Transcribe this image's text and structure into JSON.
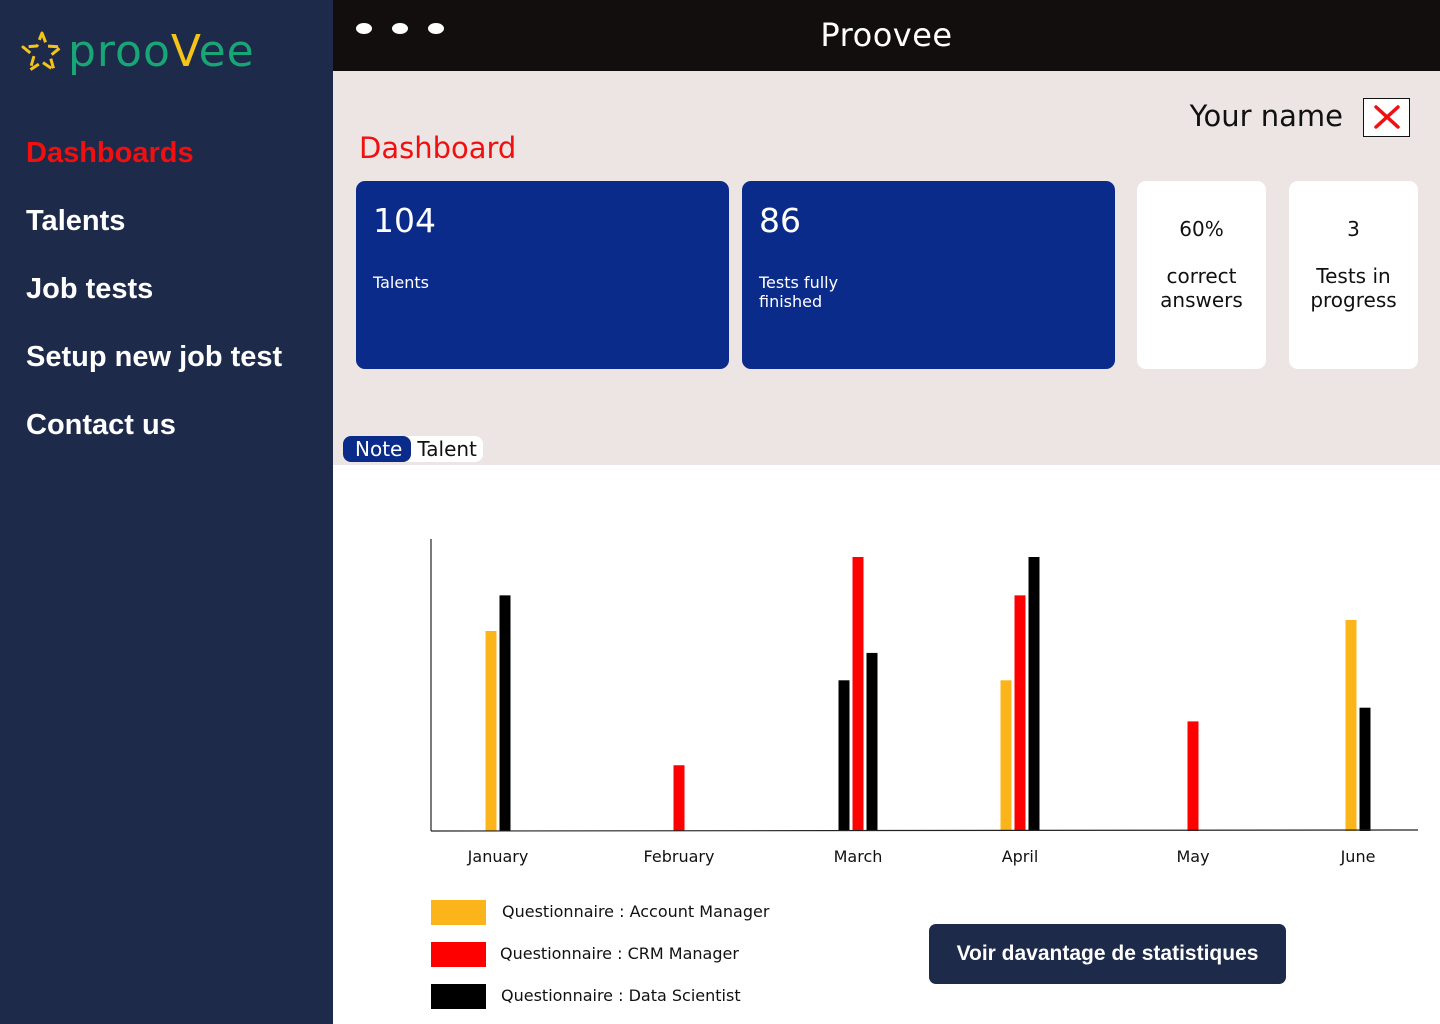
{
  "logo": {
    "text_a": "proo",
    "text_v": "V",
    "text_b": "ee"
  },
  "app_title": "Proovee",
  "sidebar": {
    "items": [
      {
        "label": "Dashboards",
        "active": true
      },
      {
        "label": "Talents",
        "active": false
      },
      {
        "label": "Job tests",
        "active": false
      },
      {
        "label": "Setup new job test",
        "active": false
      },
      {
        "label": "Contact us",
        "active": false
      }
    ]
  },
  "header": {
    "user_name": "Your name",
    "page_title": "Dashboard"
  },
  "stats": {
    "talents": {
      "value": "104",
      "label": "Talents"
    },
    "tests_finished": {
      "value": "86",
      "label_line1": "Tests fully",
      "label_line2": "finished"
    },
    "correct_answers": {
      "value": "60%",
      "label_line1": "correct",
      "label_line2": "answers"
    },
    "tests_in_progress": {
      "value": "3",
      "label_line1": "Tests in",
      "label_line2": "progress"
    }
  },
  "tabs": [
    {
      "label": "Note",
      "active": true
    },
    {
      "label": "Talent",
      "active": false
    }
  ],
  "chart_data": {
    "type": "bar",
    "categories": [
      "January",
      "February",
      "March",
      "April",
      "May",
      "June"
    ],
    "series": [
      {
        "name": "Questionnaire : Account Manager",
        "color": "#fbb51b",
        "values": [
          73,
          0,
          55,
          55,
          0,
          77
        ]
      },
      {
        "name": "Questionnaire : CRM Manager",
        "color": "#ff0000",
        "values": [
          0,
          24,
          100,
          86,
          40,
          0
        ]
      },
      {
        "name": "Questionnaire : Data Scientist",
        "color": "#000000",
        "values": [
          86,
          0,
          65,
          100,
          0,
          45
        ]
      }
    ],
    "bars_by_category": [
      [
        {
          "series": 0,
          "value": 73
        },
        {
          "series": 2,
          "value": 86
        }
      ],
      [
        {
          "series": 1,
          "value": 24
        }
      ],
      [
        {
          "series": 2,
          "value": 55
        },
        {
          "series": 1,
          "value": 100
        },
        {
          "series": 2,
          "value": 65
        }
      ],
      [
        {
          "series": 0,
          "value": 55
        },
        {
          "series": 1,
          "value": 86
        },
        {
          "series": 2,
          "value": 100
        }
      ],
      [
        {
          "series": 1,
          "value": 40
        }
      ],
      [
        {
          "series": 0,
          "value": 77
        },
        {
          "series": 2,
          "value": 45
        }
      ]
    ],
    "ylim": [
      0,
      100
    ],
    "grid": false,
    "legend": "bottom-left"
  },
  "actions": {
    "more_stats_label": "Voir davantage de statistiques"
  },
  "colors": {
    "sidebar": "#1e2a4a",
    "accent_red": "#f01010",
    "card_blue": "#0a2b8a",
    "topbar": "#120e0e",
    "header_bg": "#ede5e3"
  }
}
